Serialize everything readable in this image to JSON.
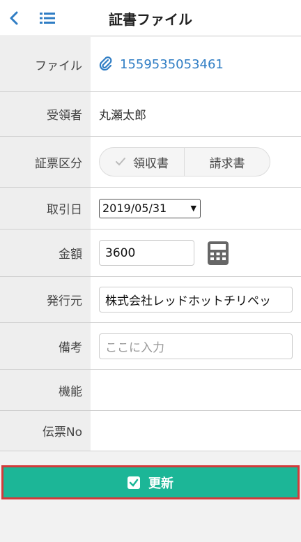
{
  "header": {
    "title": "証書ファイル",
    "back_icon": "chevron-left-icon",
    "menu_icon": "list-icon"
  },
  "form": {
    "file": {
      "label": "ファイル",
      "value": "1559535053461",
      "icon": "paperclip-icon"
    },
    "recipient": {
      "label": "受領者",
      "value": "丸瀬太郎"
    },
    "voucher_type": {
      "label": "証票区分",
      "options": [
        "領収書",
        "請求書"
      ],
      "selected": "領収書"
    },
    "transaction_date": {
      "label": "取引日",
      "value": "2019/05/31"
    },
    "amount": {
      "label": "金額",
      "value": "3600",
      "icon": "calculator-icon"
    },
    "issuer": {
      "label": "発行元",
      "value": "株式会社レッドホットチリペッ"
    },
    "notes": {
      "label": "備考",
      "placeholder": "ここに入力"
    },
    "function": {
      "label": "機能"
    },
    "slip_no": {
      "label": "伝票No"
    }
  },
  "footer": {
    "update_label": "更新",
    "icon": "checkbox-icon"
  },
  "colors": {
    "accent": "#1cb697",
    "link": "#2f7dc4",
    "highlight_border": "#d23b3b"
  }
}
